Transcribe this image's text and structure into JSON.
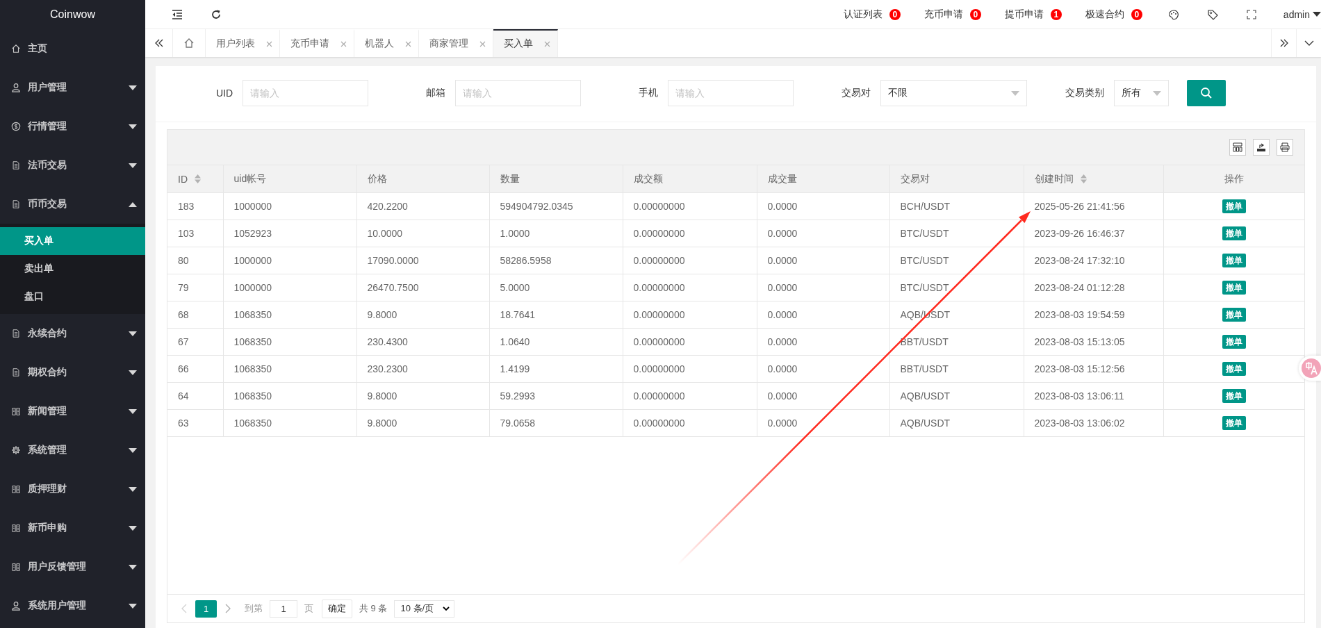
{
  "brand": "Coinwow",
  "sidebar": {
    "items": [
      {
        "label": "主页"
      },
      {
        "label": "用户管理",
        "expanded": false
      },
      {
        "label": "行情管理",
        "expanded": false
      },
      {
        "label": "法币交易",
        "expanded": false
      },
      {
        "label": "币币交易",
        "expanded": true,
        "children": [
          {
            "label": "买入单",
            "selected": true
          },
          {
            "label": "卖出单",
            "selected": false
          },
          {
            "label": "盘口",
            "selected": false
          }
        ]
      },
      {
        "label": "永续合约",
        "expanded": false
      },
      {
        "label": "期权合约",
        "expanded": false
      },
      {
        "label": "新闻管理",
        "expanded": false
      },
      {
        "label": "系统管理",
        "expanded": false
      },
      {
        "label": "质押理财",
        "expanded": false
      },
      {
        "label": "新币申购",
        "expanded": false
      },
      {
        "label": "用户反馈管理",
        "expanded": false
      },
      {
        "label": "系统用户管理",
        "expanded": false
      }
    ]
  },
  "topbar": {
    "notices": [
      {
        "label": "认证列表",
        "count": "0"
      },
      {
        "label": "充币申请",
        "count": "0"
      },
      {
        "label": "提币申请",
        "count": "1"
      },
      {
        "label": "极速合约",
        "count": "0"
      }
    ],
    "user": "admin"
  },
  "tabs": [
    {
      "label": "用户列表",
      "selected": false
    },
    {
      "label": "充币申请",
      "selected": false
    },
    {
      "label": "机器人",
      "selected": false
    },
    {
      "label": "商家管理",
      "selected": false
    },
    {
      "label": "买入单",
      "selected": true
    }
  ],
  "filters": [
    {
      "kind": "input",
      "label": "UID",
      "placeholder": "请输入"
    },
    {
      "kind": "input",
      "label": "邮箱",
      "placeholder": "请输入"
    },
    {
      "kind": "input",
      "label": "手机",
      "placeholder": "请输入"
    },
    {
      "kind": "select",
      "label": "交易对",
      "value": "不限"
    },
    {
      "kind": "select",
      "label": "交易类别",
      "value": "所有"
    }
  ],
  "table": {
    "columns": [
      {
        "label": "ID",
        "sortable": true
      },
      {
        "label": "uid帐号",
        "sortable": false
      },
      {
        "label": "价格",
        "sortable": false
      },
      {
        "label": "数量",
        "sortable": false
      },
      {
        "label": "成交额",
        "sortable": false
      },
      {
        "label": "成交量",
        "sortable": false
      },
      {
        "label": "交易对",
        "sortable": false
      },
      {
        "label": "创建时间",
        "sortable": true
      },
      {
        "label": "操作",
        "sortable": false
      }
    ],
    "rows": [
      {
        "cells": [
          "183",
          "1000000",
          "420.2200",
          "594904792.0345",
          "0.00000000",
          "0.0000",
          "BCH/USDT",
          "2025-05-26 21:41:56"
        ],
        "action": "撤单"
      },
      {
        "cells": [
          "103",
          "1052923",
          "10.0000",
          "1.0000",
          "0.00000000",
          "0.0000",
          "BTC/USDT",
          "2023-09-26 16:46:37"
        ],
        "action": "撤单"
      },
      {
        "cells": [
          "80",
          "1000000",
          "17090.0000",
          "58286.5958",
          "0.00000000",
          "0.0000",
          "BTC/USDT",
          "2023-08-24 17:32:10"
        ],
        "action": "撤单"
      },
      {
        "cells": [
          "79",
          "1000000",
          "26470.7500",
          "5.0000",
          "0.00000000",
          "0.0000",
          "BTC/USDT",
          "2023-08-24 01:12:28"
        ],
        "action": "撤单"
      },
      {
        "cells": [
          "68",
          "1068350",
          "9.8000",
          "18.7641",
          "0.00000000",
          "0.0000",
          "AQB/USDT",
          "2023-08-03 19:54:59"
        ],
        "action": "撤单"
      },
      {
        "cells": [
          "67",
          "1068350",
          "230.4300",
          "1.0640",
          "0.00000000",
          "0.0000",
          "BBT/USDT",
          "2023-08-03 15:13:05"
        ],
        "action": "撤单"
      },
      {
        "cells": [
          "66",
          "1068350",
          "230.2300",
          "1.4199",
          "0.00000000",
          "0.0000",
          "BBT/USDT",
          "2023-08-03 15:12:56"
        ],
        "action": "撤单"
      },
      {
        "cells": [
          "64",
          "1068350",
          "9.8000",
          "59.2993",
          "0.00000000",
          "0.0000",
          "AQB/USDT",
          "2023-08-03 13:06:11"
        ],
        "action": "撤单"
      },
      {
        "cells": [
          "63",
          "1068350",
          "9.8000",
          "79.0658",
          "0.00000000",
          "0.0000",
          "AQB/USDT",
          "2023-08-03 13:06:02"
        ],
        "action": "撤单"
      }
    ]
  },
  "pagination": {
    "prev_disabled": true,
    "pages": [
      {
        "label": "1",
        "selected": true
      }
    ],
    "goto_label": "到第",
    "goto_value": "1",
    "page_unit": "页",
    "confirm": "确定",
    "total": "共 9 条",
    "page_size": "10 条/页"
  }
}
